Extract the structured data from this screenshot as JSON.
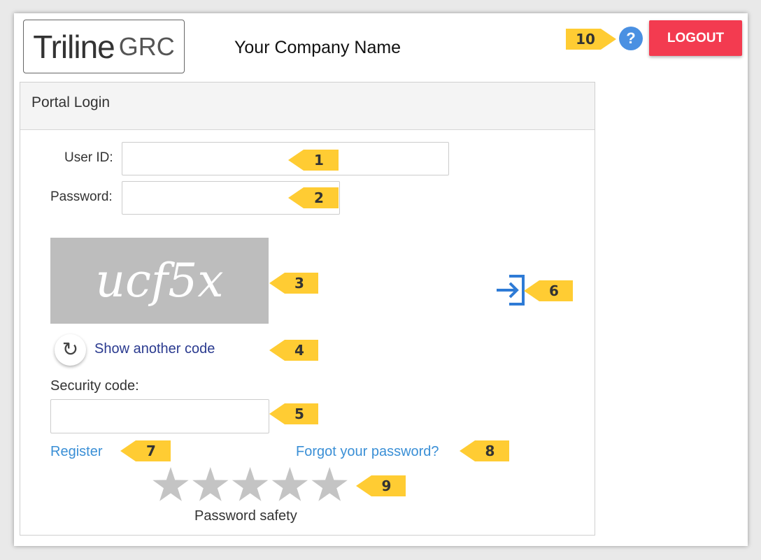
{
  "header": {
    "logo_main": "Triline",
    "logo_sub": "GRC",
    "company_name": "Your Company Name",
    "help_symbol": "?",
    "logout_label": "LOGOUT"
  },
  "panel": {
    "title": "Portal Login",
    "user_id_label": "User ID:",
    "password_label": "Password:",
    "captcha_text": "ucf5x",
    "refresh_symbol": "↻",
    "show_another_code": "Show another code",
    "security_code_label": "Security code:",
    "register_label": "Register",
    "forgot_password_label": "Forgot your password?",
    "password_safety_label": "Password safety",
    "password_safety_stars": {
      "filled": 0,
      "total": 5
    }
  },
  "callouts": [
    "1",
    "2",
    "3",
    "4",
    "5",
    "6",
    "7",
    "8",
    "9",
    "10"
  ],
  "icons": {
    "help": "help-icon",
    "logout": "logout-button",
    "refresh": "refresh-icon",
    "login": "login-arrow-icon",
    "star": "star-icon"
  },
  "colors": {
    "logout": "#f33b50",
    "help": "#4a90e2",
    "callout": "#ffcc33",
    "link": "#3a8fd6",
    "captcha_bg": "#bdbdbd",
    "star_empty": "#c4c4c4",
    "login_icon": "#2e7bd6"
  }
}
